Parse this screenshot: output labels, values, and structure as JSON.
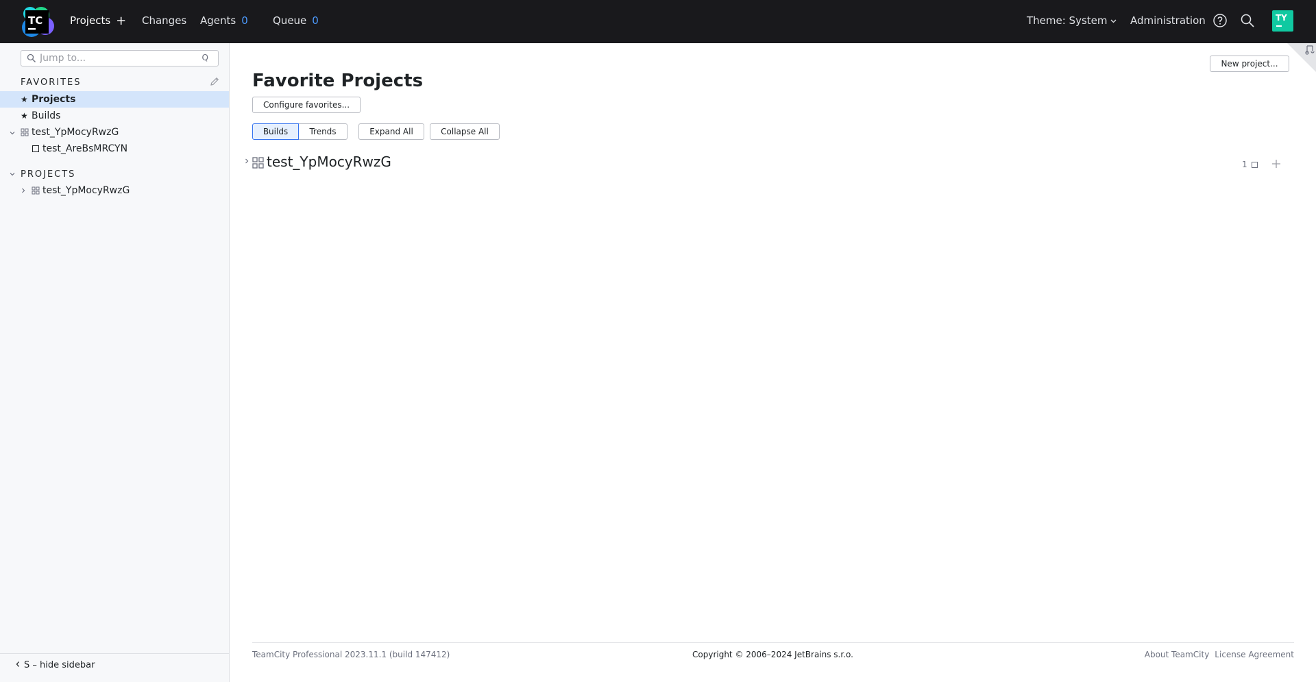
{
  "header": {
    "logo_text": "TC",
    "nav": {
      "projects": "Projects",
      "changes": "Changes",
      "agents": "Agents",
      "agents_count": "0",
      "queue": "Queue",
      "queue_count": "0"
    },
    "theme": "Theme: System",
    "administration": "Administration",
    "avatar_initials": "TY",
    "colors": {
      "background": "#19191c",
      "count": "#4d9bff",
      "avatar": "#10c9a1"
    }
  },
  "sidebar": {
    "search_placeholder": "Jump to...",
    "search_hint": "Q",
    "favorites_title": "FAVORITES",
    "favorites": [
      {
        "label": "Projects",
        "icon": "star-icon",
        "selected": true
      },
      {
        "label": "Builds",
        "icon": "star-icon",
        "selected": false
      }
    ],
    "favorite_project": {
      "label": "test_YpMocyRwzG",
      "expanded": true
    },
    "favorite_build_config": {
      "label": "test_AreBsMRCYN"
    },
    "projects_title": "PROJECTS",
    "projects": [
      {
        "label": "test_YpMocyRwzG",
        "expanded": false
      }
    ],
    "hide_sidebar": "S – hide sidebar"
  },
  "main": {
    "title": "Favorite Projects",
    "configure_favorites": "Configure favorites...",
    "new_project": "New project...",
    "view_tabs": [
      {
        "label": "Builds",
        "selected": true
      },
      {
        "label": "Trends",
        "selected": false
      }
    ],
    "expand_all": "Expand All",
    "collapse_all": "Collapse All",
    "project_row": {
      "label": "test_YpMocyRwzG",
      "build_config_count": "1"
    }
  },
  "footer": {
    "version": "TeamCity Professional 2023.11.1 (build 147412)",
    "copyright": "Copyright © 2006–2024 JetBrains s.r.o.",
    "about": "About TeamCity",
    "license": "License Agreement"
  }
}
